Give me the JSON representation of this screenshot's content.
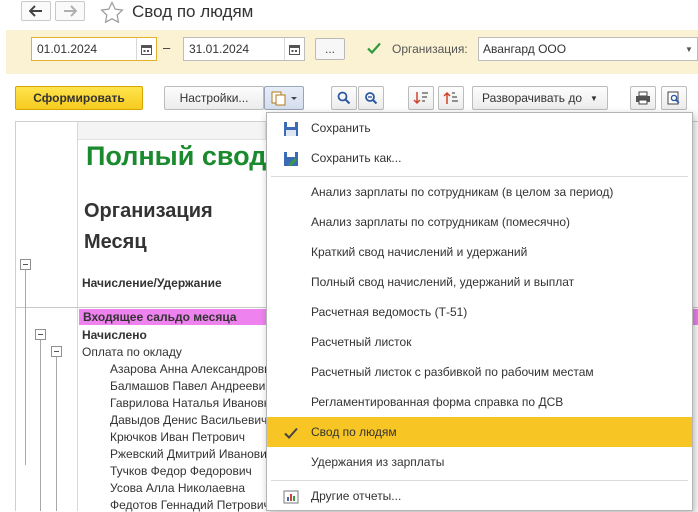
{
  "window": {
    "title": "Свод по людям"
  },
  "filters": {
    "date_from": "01.01.2024",
    "date_to": "31.01.2024",
    "range_dash": "–",
    "more_button": "...",
    "org_checked": true,
    "org_label": "Организация:",
    "org_value": "Авангард ООО"
  },
  "toolbar": {
    "generate_label": "Сформировать",
    "settings_label": "Настройки...",
    "expand_label": "Разворачивать до"
  },
  "report": {
    "title": "Полный свод",
    "org_header": "Организация",
    "month_header": "Месяц",
    "column_header": "Начисление/Удержание",
    "opening_balance": "Входящее сальдо месяца",
    "accrued": "Начислено",
    "salary_group": "Оплата по окладу",
    "employees": [
      "Азарова Анна Александровна",
      "Балмашов Павел Андреевич",
      "Гаврилова Наталья Ивановна",
      "Давыдов Денис Васильевич",
      "Крючков Иван Петрович",
      "Ржевский Дмитрий Иванович",
      "Тучков Федор Федорович",
      "Усова Алла Николаевна",
      "Федотов Геннадий Петрович"
    ]
  },
  "menu": {
    "items": [
      {
        "label": "Сохранить",
        "icon": "save-icon"
      },
      {
        "label": "Сохранить как...",
        "icon": "save-as-icon"
      },
      {
        "label": "Анализ зарплаты по сотрудникам (в целом за период)"
      },
      {
        "label": "Анализ зарплаты по сотрудникам (помесячно)"
      },
      {
        "label": "Краткий свод начислений и удержаний"
      },
      {
        "label": "Полный свод начислений, удержаний и выплат"
      },
      {
        "label": "Расчетная ведомость (Т-51)"
      },
      {
        "label": "Расчетный листок"
      },
      {
        "label": "Расчетный листок с разбивкой по рабочим местам"
      },
      {
        "label": "Регламентированная форма справка по ДСВ"
      },
      {
        "label": "Свод по людям",
        "selected": true
      },
      {
        "label": "Удержания из зарплаты"
      },
      {
        "label": "Другие отчеты...",
        "icon": "other-reports-icon"
      }
    ]
  },
  "colors": {
    "accent_yellow": "#f7c624",
    "report_title_green": "#1a8a2e",
    "balance_row_pink": "#ee82ee",
    "filter_bar_bg": "#fbf2d4"
  }
}
